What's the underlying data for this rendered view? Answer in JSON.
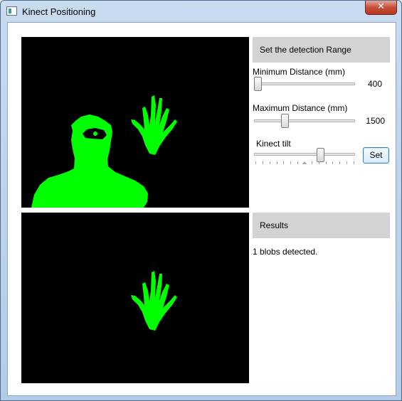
{
  "window": {
    "title": "Kinect Positioning",
    "close_glyph": "✕",
    "icon": "app-window-icon"
  },
  "range_section": {
    "header": "Set the detection Range",
    "min_label": "Minimum Distance (mm)",
    "min_value": "400",
    "min_fraction": 0.0,
    "max_label": "Maximum Distance (mm)",
    "max_value": "1500",
    "max_fraction": 0.29,
    "tilt_label": "Kinect tilt",
    "tilt_fraction": 0.67,
    "set_label": "Set"
  },
  "results_section": {
    "header": "Results",
    "text": "1 blobs detected."
  },
  "colors": {
    "blob": "#00ff00",
    "background": "#000000",
    "header_bg": "#d3d3d3"
  }
}
